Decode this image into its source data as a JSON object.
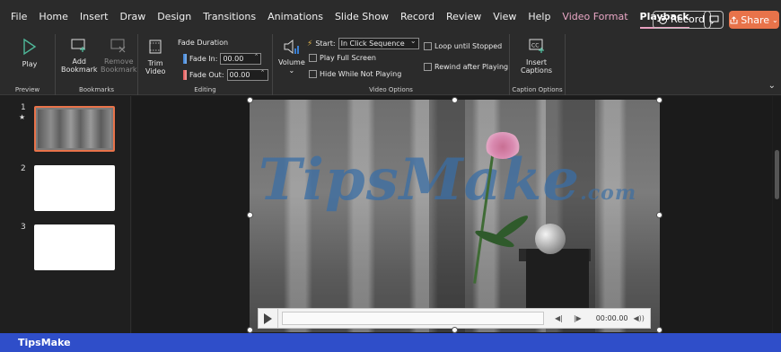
{
  "menu": {
    "tabs": [
      "File",
      "Home",
      "Insert",
      "Draw",
      "Design",
      "Transitions",
      "Animations",
      "Slide Show",
      "Record",
      "Review",
      "View",
      "Help",
      "Video Format",
      "Playback"
    ],
    "active_tab": "Playback",
    "record_label": "Record",
    "share_label": "Share"
  },
  "ribbon": {
    "preview": {
      "play_label": "Play",
      "group_label": "Preview"
    },
    "bookmarks": {
      "add_label_1": "Add",
      "add_label_2": "Bookmark",
      "remove_label_1": "Remove",
      "remove_label_2": "Bookmark",
      "group_label": "Bookmarks"
    },
    "editing": {
      "trim_label_1": "Trim",
      "trim_label_2": "Video",
      "fade_duration": "Fade Duration",
      "fade_in_label": "Fade In:",
      "fade_in_value": "00.00",
      "fade_out_label": "Fade Out:",
      "fade_out_value": "00.00",
      "group_label": "Editing"
    },
    "video_options": {
      "volume_label": "Volume",
      "start_label": "Start:",
      "start_value": "In Click Sequence",
      "play_full_screen": "Play Full Screen",
      "hide_while_not_playing": "Hide While Not Playing",
      "loop_until_stopped": "Loop until Stopped",
      "rewind_after_playing": "Rewind after Playing",
      "group_label": "Video Options"
    },
    "caption_options": {
      "insert_label_1": "Insert",
      "insert_label_2": "Captions",
      "group_label": "Caption Options"
    }
  },
  "slides": [
    {
      "number": "1",
      "star": "★",
      "selected": true
    },
    {
      "number": "2",
      "selected": false
    },
    {
      "number": "3",
      "selected": false
    }
  ],
  "video": {
    "watermark": "TipsMake",
    "watermark_suffix": ".com",
    "time": "00:00.00"
  },
  "status": {
    "text": "TipsMake"
  },
  "colors": {
    "accent": "#e8734a",
    "status_bar": "#2f4ec9",
    "playback_underline": "#e8a0bf"
  }
}
